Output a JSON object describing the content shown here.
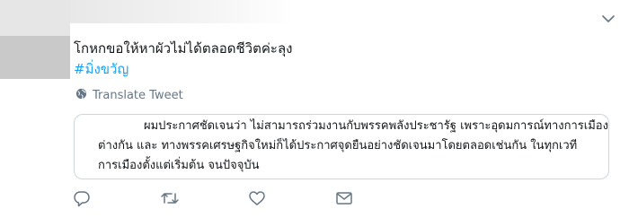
{
  "tweet": {
    "text": "โกหกขอให้หาผัวไม่ได้ตลอดชีวิตค่ะลุง",
    "hashtag": "#มิ่งขวัญ",
    "translate_label": "Translate Tweet"
  },
  "card": {
    "lines": [
      "ผมประกาศชัดเจนว่า ไม่สามารถร่วมงานกับพรรคพลังประชารัฐ เพราะอุดมการณ์ทางการเมือง",
      "ต่างกัน และ ทางพรรคเศรษฐกิจใหม่ก็ได้ประกาศจุดยืนอย่างชัดเจนมาโดยตลอดเช่นกัน ในทุกเวที",
      "การเมืองตั้งแต่เริ่มต้น จนปัจจุบัน"
    ]
  },
  "icons": {
    "more": "chevron-down-icon",
    "translate": "globe-icon",
    "reply": "reply-icon",
    "retweet": "retweet-icon",
    "like": "heart-icon",
    "dm": "envelope-icon"
  },
  "colors": {
    "text": "#14171a",
    "hashtag": "#1da1f2",
    "muted": "#657786",
    "border": "#ccd6dd"
  }
}
